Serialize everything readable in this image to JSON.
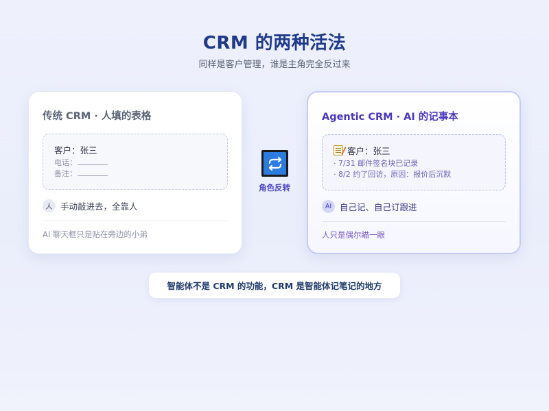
{
  "header": {
    "title": "CRM 的两种活法",
    "subtitle": "同样是客户管理，谁是主角完全反过来"
  },
  "left_card": {
    "title": "传统 CRM · 人填的表格",
    "record": {
      "customer": "客户：张三",
      "phone_label": "电话：",
      "note_label": "备注："
    },
    "avatar_text": "人",
    "who_text": "手动敲进去，全靠人",
    "footnote": "AI 聊天框只是贴在旁边的小弟"
  },
  "right_card": {
    "title": "Agentic CRM · AI 的记事本",
    "record": {
      "customer": "客户：张三",
      "line1": "· 7/31 邮件签名块已记录",
      "line2": "· 8/2 约了回访，原因：报价后沉默"
    },
    "avatar_text": "AI",
    "who_text": "自己记、自己订跟进",
    "footnote": "人只是偶尔瞄一眼"
  },
  "swap": {
    "label": "角色反转",
    "icon": "swap-arrows-icon"
  },
  "bottom_note": "智能体不是 CRM 的功能，CRM 是智能体记笔记的地方",
  "colors": {
    "title": "#1f3a8a",
    "accent_purple": "#4a36c4",
    "swap_blue": "#2c7be0",
    "right_border": "#c5cbf4"
  }
}
